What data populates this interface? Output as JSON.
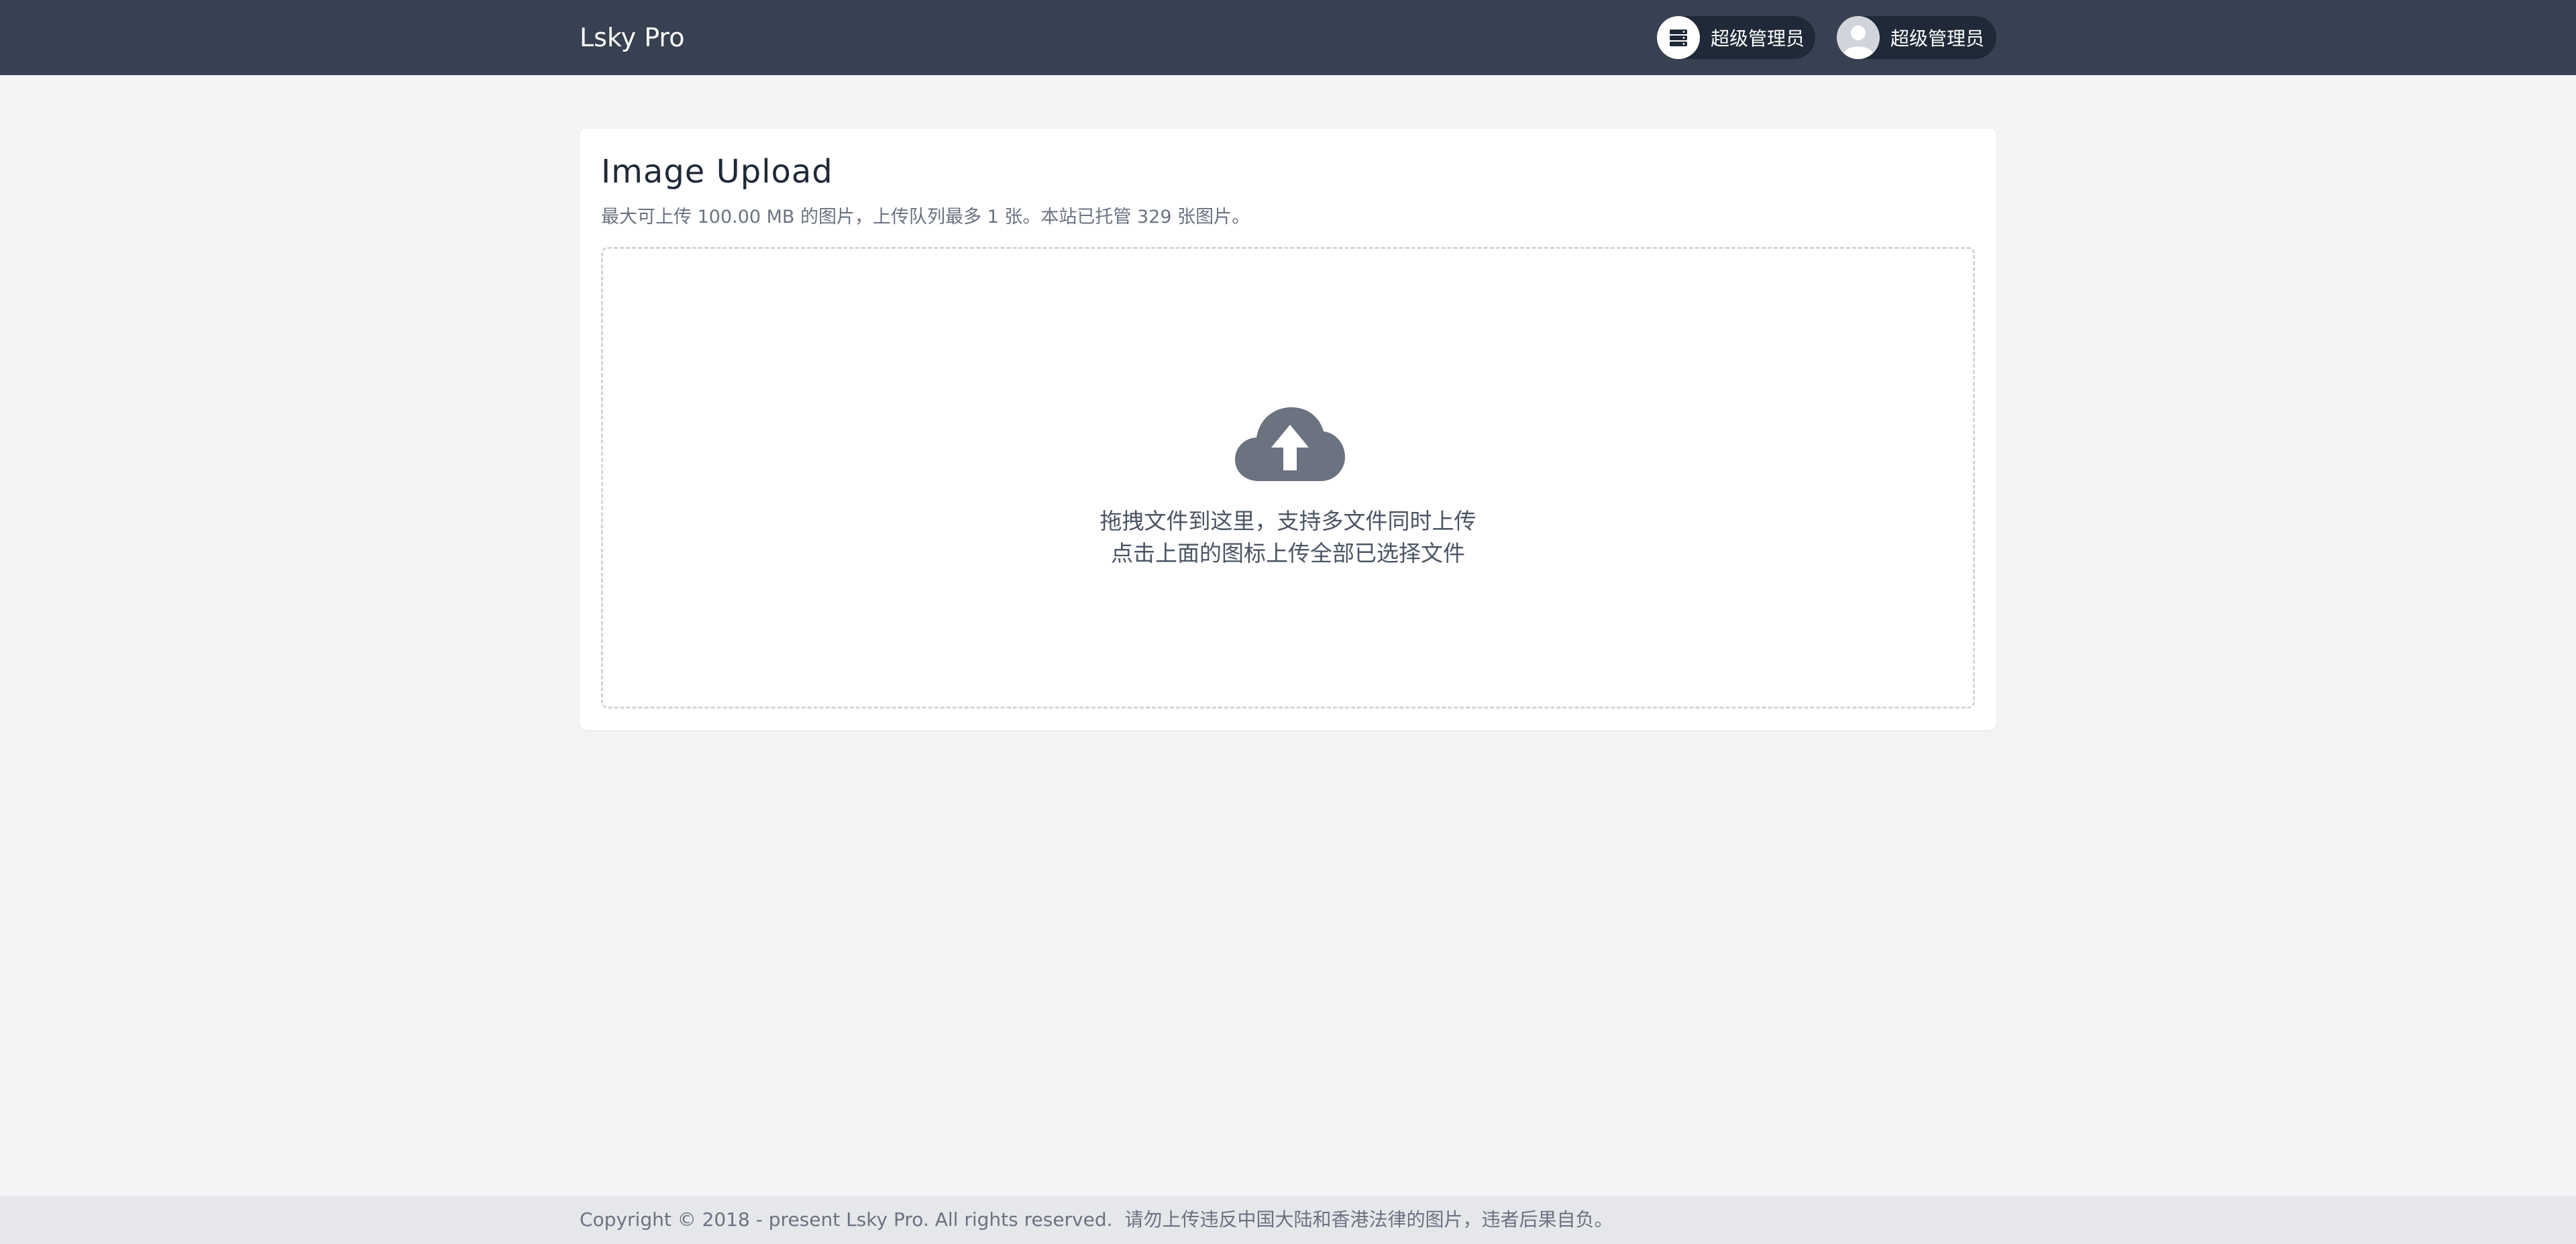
{
  "navbar": {
    "brand": "Lsky Pro",
    "storage_label": "超级管理员",
    "user_label": "超级管理员",
    "storage_icon": "server-stack-icon",
    "avatar_icon": "user-avatar-icon"
  },
  "upload": {
    "title": "Image Upload",
    "subtitle": "最大可上传 100.00 MB 的图片，上传队列最多 1 张。本站已托管 329 张图片。",
    "icon": "cloud-upload-icon",
    "line1": "拖拽文件到这里，支持多文件同时上传",
    "line2": "点击上面的图标上传全部已选择文件"
  },
  "footer": {
    "copyright": "Copyright © 2018 - present Lsky Pro. All rights reserved.",
    "notice": "请勿上传违反中国大陆和香港法律的图片，违者后果自负。"
  },
  "colors": {
    "navbar": "#374151",
    "pill": "#1f2937",
    "background": "#f3f4f6",
    "icon_gray": "#6b7280"
  }
}
